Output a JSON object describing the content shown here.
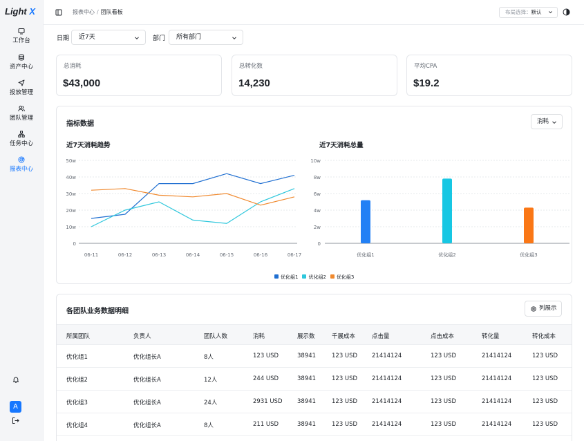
{
  "app": {
    "logo_text": "Light",
    "logo_accent": "X",
    "accent": "#1677ff"
  },
  "sidebar": {
    "items": [
      {
        "label": "工作台",
        "icon": "dashboard-icon"
      },
      {
        "label": "资产中心",
        "icon": "database-icon"
      },
      {
        "label": "投放管理",
        "icon": "send-icon"
      },
      {
        "label": "团队管理",
        "icon": "users-icon"
      },
      {
        "label": "任务中心",
        "icon": "hierarchy-icon"
      },
      {
        "label": "报表中心",
        "icon": "report-icon",
        "active": true
      }
    ],
    "avatar_letter": "A"
  },
  "header": {
    "breadcrumb": [
      "报表中心",
      "团队看板"
    ],
    "layout_label": "布局选择：",
    "layout_value": "默认"
  },
  "filters": {
    "date_label": "日期",
    "date_value": "近7天",
    "dept_label": "部门",
    "dept_value": "所有部门"
  },
  "kpis": [
    {
      "title": "总消耗",
      "value": "$43,000"
    },
    {
      "title": "总转化数",
      "value": "14,230"
    },
    {
      "title": "平均CPA",
      "value": "$19.2"
    }
  ],
  "metrics": {
    "title": "指标数据",
    "metric_select": "消耗"
  },
  "chart_data": [
    {
      "type": "line",
      "title": "近7天消耗趋势",
      "x": [
        "06-11",
        "06-12",
        "06-13",
        "06-14",
        "06-15",
        "06-16",
        "06-17"
      ],
      "yticks": [
        "0",
        "10w",
        "20w",
        "30w",
        "40w",
        "50w"
      ],
      "ylim": [
        0,
        50
      ],
      "grid": true,
      "legend_position": "bottom",
      "series": [
        {
          "name": "优化组1",
          "color": "#1f6fd1",
          "values": [
            15,
            17.5,
            36,
            36,
            42,
            36,
            41
          ]
        },
        {
          "name": "优化组2",
          "color": "#2ec7dc",
          "values": [
            10,
            20,
            25,
            14,
            12,
            25,
            33
          ]
        },
        {
          "name": "优化组3",
          "color": "#f0892e",
          "values": [
            32,
            33,
            29,
            28,
            30,
            23,
            28
          ]
        }
      ]
    },
    {
      "type": "bar",
      "title": "近7天消耗总量",
      "categories": [
        "优化组1",
        "优化组2",
        "优化组3"
      ],
      "values": [
        5.2,
        7.8,
        4.3
      ],
      "colors": [
        "#2280f5",
        "#17c7e3",
        "#fa7716"
      ],
      "yticks": [
        "0",
        "2w",
        "4w",
        "6w",
        "8w",
        "10w"
      ],
      "ylim": [
        0,
        10
      ],
      "grid": true
    }
  ],
  "table": {
    "title": "各团队业务数据明细",
    "columns_button": "列展示",
    "columns": [
      "所属团队",
      "负责人",
      "团队人数",
      "消耗",
      "展示数",
      "千展成本",
      "点击量",
      "点击成本",
      "转化量",
      "转化成本"
    ],
    "rows": [
      [
        "优化组1",
        "优化组长A",
        "8人",
        "123 USD",
        "38941",
        "123 USD",
        "21414124",
        "123 USD",
        "21414124",
        "123 USD"
      ],
      [
        "优化组2",
        "优化组长A",
        "12人",
        "244 USD",
        "38941",
        "123 USD",
        "21414124",
        "123 USD",
        "21414124",
        "123 USD"
      ],
      [
        "优化组3",
        "优化组长A",
        "24人",
        "2931 USD",
        "38941",
        "123 USD",
        "21414124",
        "123 USD",
        "21414124",
        "123 USD"
      ],
      [
        "优化组4",
        "优化组长A",
        "8人",
        "211 USD",
        "38941",
        "123 USD",
        "21414124",
        "123 USD",
        "21414124",
        "123 USD"
      ]
    ]
  }
}
